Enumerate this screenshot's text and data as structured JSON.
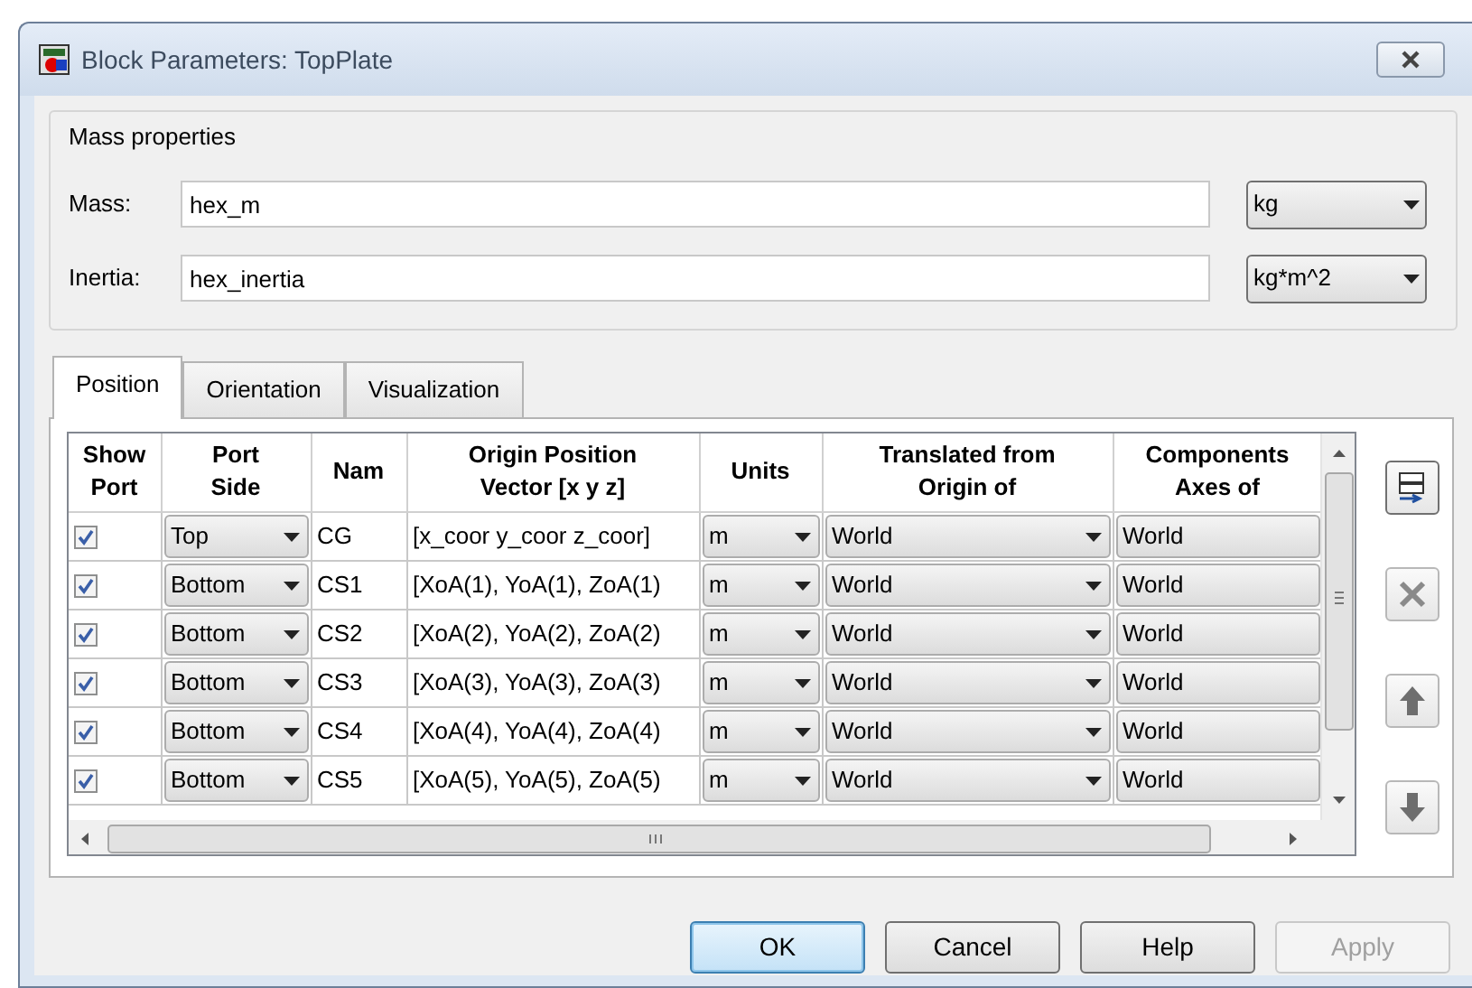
{
  "window": {
    "title": "Block Parameters: TopPlate"
  },
  "mass_properties": {
    "legend": "Mass properties",
    "fields": [
      {
        "label": "Mass:",
        "value": "hex_m",
        "unit": "kg"
      },
      {
        "label": "Inertia:",
        "value": "hex_inertia",
        "unit": "kg*m^2"
      }
    ]
  },
  "tabs": [
    {
      "label": "Position",
      "selected": true
    },
    {
      "label": "Orientation",
      "selected": false
    },
    {
      "label": "Visualization",
      "selected": false
    }
  ],
  "table": {
    "columns": [
      [
        "Show",
        "Port"
      ],
      [
        "Port",
        "Side"
      ],
      [
        "Nam"
      ],
      [
        "Origin Position",
        "Vector [x y z]"
      ],
      [
        "Units"
      ],
      [
        "Translated from",
        "Origin of"
      ],
      [
        "Components",
        "Axes of"
      ]
    ],
    "rows": [
      {
        "show_port": true,
        "port_side": "Top",
        "name": "CG",
        "origin": "[x_coor y_coor z_coor]",
        "units": "m",
        "translated_from": "World",
        "components": "World"
      },
      {
        "show_port": true,
        "port_side": "Bottom",
        "name": "CS1",
        "origin": "[XoA(1), YoA(1), ZoA(1)",
        "units": "m",
        "translated_from": "World",
        "components": "World"
      },
      {
        "show_port": true,
        "port_side": "Bottom",
        "name": "CS2",
        "origin": "[XoA(2), YoA(2), ZoA(2)",
        "units": "m",
        "translated_from": "World",
        "components": "World"
      },
      {
        "show_port": true,
        "port_side": "Bottom",
        "name": "CS3",
        "origin": "[XoA(3), YoA(3), ZoA(3)",
        "units": "m",
        "translated_from": "World",
        "components": "World"
      },
      {
        "show_port": true,
        "port_side": "Bottom",
        "name": "CS4",
        "origin": "[XoA(4), YoA(4), ZoA(4)",
        "units": "m",
        "translated_from": "World",
        "components": "World"
      },
      {
        "show_port": true,
        "port_side": "Bottom",
        "name": "CS5",
        "origin": "[XoA(5), YoA(5), ZoA(5)",
        "units": "m",
        "translated_from": "World",
        "components": "World"
      }
    ]
  },
  "side_buttons": [
    {
      "kind": "add"
    },
    {
      "kind": "delete"
    },
    {
      "kind": "up"
    },
    {
      "kind": "down"
    }
  ],
  "buttons": [
    {
      "label": "OK",
      "default": true,
      "disabled": false
    },
    {
      "label": "Cancel",
      "default": false,
      "disabled": false
    },
    {
      "label": "Help",
      "default": false,
      "disabled": false
    },
    {
      "label": "Apply",
      "default": false,
      "disabled": true
    }
  ]
}
